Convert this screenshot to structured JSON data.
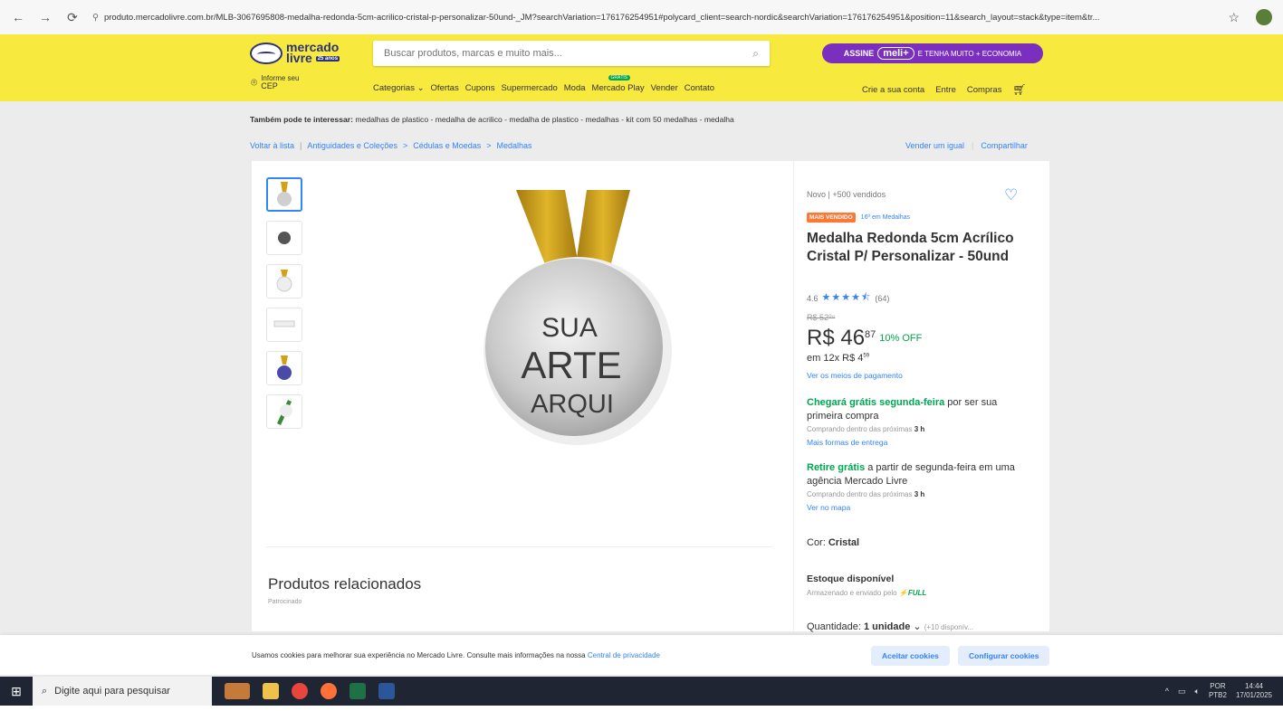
{
  "browser": {
    "url": "produto.mercadolivre.com.br/MLB-3067695808-medalha-redonda-5cm-acrilico-cristal-p-personalizar-50und-_JM?searchVariation=176176254951#polycard_client=search-nordic&searchVariation=176176254951&position=11&search_layout=stack&type=item&tr..."
  },
  "header": {
    "logo_line1": "mercado",
    "logo_line2": "livre",
    "logo_badge": "25 anos",
    "search_placeholder": "Buscar produtos, marcas e muito mais...",
    "promo": {
      "assine": "ASSINE",
      "meli": "meli+",
      "rest": "E TENHA MUITO + ECONOMIA"
    },
    "cep_line1": "Informe seu",
    "cep_line2": "CEP",
    "nav": [
      "Categorias ⌄",
      "Ofertas",
      "Cupons",
      "Supermercado",
      "Moda",
      "Mercado Play",
      "Vender",
      "Contato"
    ],
    "play_badge": "GRÁTIS",
    "user_nav": [
      "Crie a sua conta",
      "Entre",
      "Compras"
    ]
  },
  "also_interest": {
    "label": "Também pode te interessar:",
    "items": "medalhas de plastico - medalha de acrilico - medalha de plastico - medalhas - kit com 50 medalhas - medalha"
  },
  "breadcrumb": {
    "back": "Voltar à lista",
    "sep": "|",
    "c1": "Antiguidades e Coleções",
    "c2": "Cédulas e Moedas",
    "c3": "Medalhas",
    "arrow": ">",
    "sell_same": "Vender um igual",
    "share": "Compartilhar"
  },
  "product": {
    "image_text": [
      "SUA",
      "ARTE",
      "ARQUI"
    ],
    "condition": "Novo  |  +500 vendidos",
    "bestseller_tag": "MAIS VENDIDO",
    "rank": "16º em Medalhas",
    "title": "Medalha Redonda 5cm Acrílico Cristal P/ Personalizar - 50und",
    "rating_value": "4.6",
    "rating_stars": 4.5,
    "rating_count": "(64)",
    "old_price": "R$ 52⁰⁸",
    "price_int": "R$ 46",
    "price_cents": "87",
    "discount": "10% OFF",
    "installments": "em 12x R$ 4",
    "installments_cents": "59",
    "payment_link": "Ver os meios de pagamento",
    "ship1_green": "Chegará grátis segunda-feira",
    "ship1_rest": " por ser sua primeira compra",
    "ship1_sub": "Comprando dentro das próximas",
    "ship1_time": "3 h",
    "ship1_link": "Mais formas de entrega",
    "ship2_green": "Retire grátis",
    "ship2_rest": " a partir de segunda-feira em uma agência Mercado Livre",
    "ship2_sub": "Comprando dentro das próximas",
    "ship2_time": "3 h",
    "ship2_link": "Ver no mapa",
    "color_label": "Cor:",
    "color_value": "Cristal",
    "stock_title": "Estoque disponível",
    "stock_sub": "Armazenado e enviado pelo",
    "full": "FULL",
    "qty_label": "Quantidade:",
    "qty_value": "1 unidade",
    "qty_avail": "(+10 disponív..."
  },
  "related": {
    "title": "Produtos relacionados",
    "sponsored": "Patrocinado"
  },
  "cookie": {
    "message": "Usamos cookies para melhorar sua experiência no Mercado Livre. Consulte mais informações na nossa ",
    "link": "Central de privacidade",
    "accept": "Aceitar cookies",
    "configure": "Configurar cookies"
  },
  "taskbar": {
    "search_placeholder": "Digite aqui para pesquisar",
    "lang1": "POR",
    "lang2": "PTB2",
    "time": "14:44",
    "date": "17/01/2025"
  },
  "colors": {
    "ml_yellow": "#f7e93e",
    "ml_blue": "#3483fa",
    "green": "#00a650",
    "meli_purple": "#7b2fbf",
    "tag_orange": "#ff7733"
  }
}
